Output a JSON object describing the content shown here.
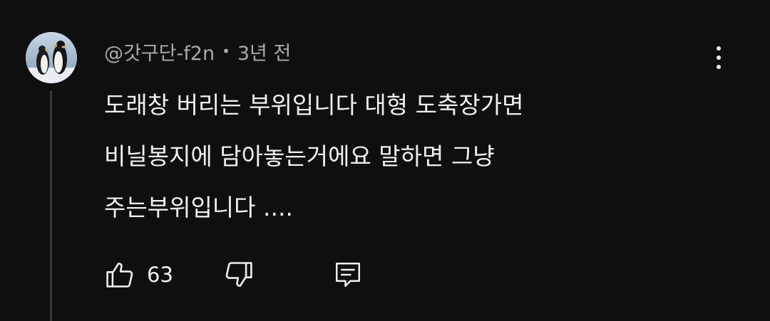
{
  "comment": {
    "author": "@갓구단-f2n",
    "separator": "•",
    "timestamp": "3년 전",
    "lines": [
      "도래창 버리는 부위입니다 대형 도축장가면",
      "비닐봉지에 담아놓는거에요 말하면 그냥",
      "주는부위입니다 ...."
    ],
    "like_count": "63",
    "avatar_icon": "penguin-avatar",
    "icons": {
      "menu": "more-vert-icon",
      "like": "thumbs-up-icon",
      "dislike": "thumbs-down-icon",
      "reply": "comment-reply-icon"
    }
  },
  "theme": {
    "background": "#0f0f0f",
    "text_primary": "#f1f1f1",
    "text_secondary": "#aaaaaa",
    "thread_line": "#3a3a3a"
  }
}
